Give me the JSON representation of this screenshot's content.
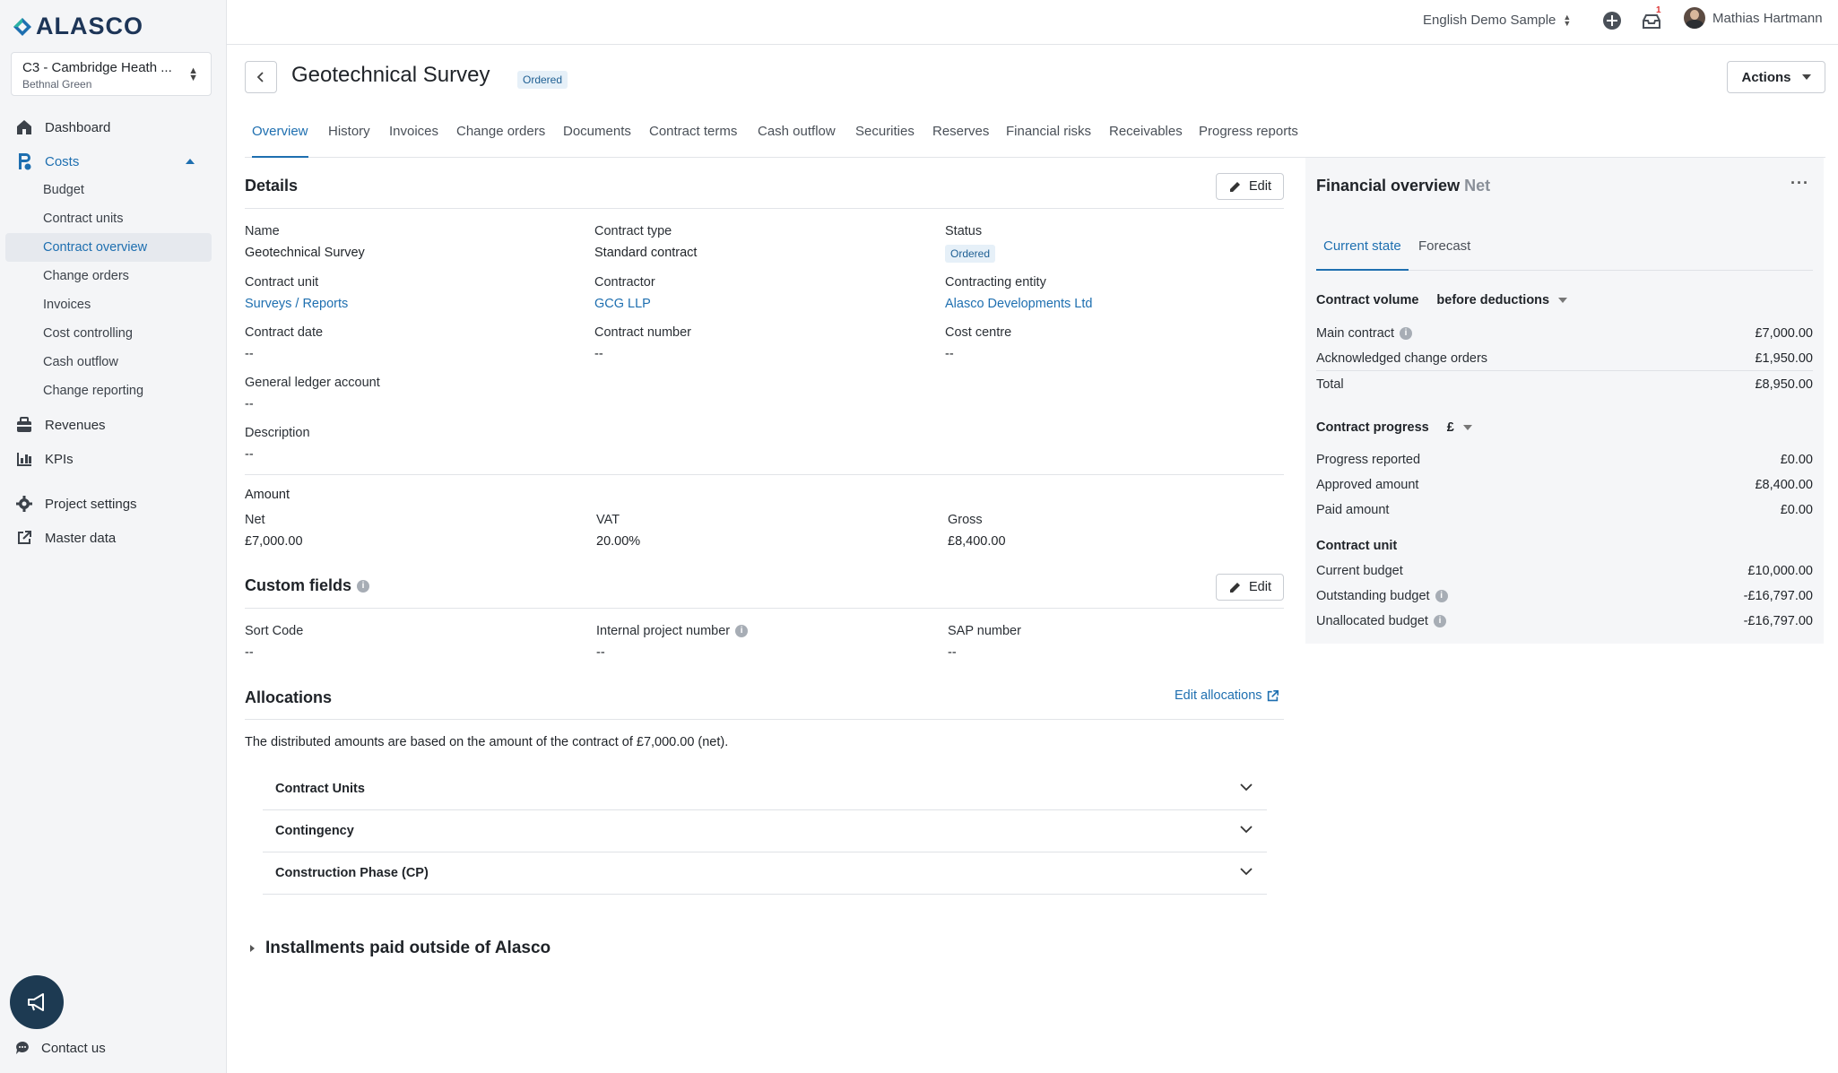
{
  "app": {
    "logo_text": "ALASCO",
    "project_name": "C3 - Cambridge Heath ...",
    "project_location": "Bethnal Green"
  },
  "nav": {
    "dashboard": "Dashboard",
    "costs": "Costs",
    "costs_children": [
      "Budget",
      "Contract units",
      "Contract overview",
      "Change orders",
      "Invoices",
      "Cost controlling",
      "Cash outflow",
      "Change reporting"
    ],
    "revenues": "Revenues",
    "kpis": "KPIs",
    "project_settings": "Project settings",
    "master_data": "Master data",
    "contact": "Contact us"
  },
  "topbar": {
    "language": "English Demo Sample",
    "notification_count": "1",
    "user_name": "Mathias Hartmann"
  },
  "header": {
    "title": "Geotechnical Survey",
    "status_badge": "Ordered",
    "actions_label": "Actions"
  },
  "tabs": [
    "Overview",
    "History",
    "Invoices",
    "Change orders",
    "Documents",
    "Contract terms",
    "Cash outflow",
    "Securities",
    "Reserves",
    "Financial risks",
    "Receivables",
    "Progress reports"
  ],
  "details": {
    "title": "Details",
    "edit_label": "Edit",
    "name_label": "Name",
    "name_value": "Geotechnical Survey",
    "contract_type_label": "Contract type",
    "contract_type_value": "Standard contract",
    "status_label": "Status",
    "status_value": "Ordered",
    "contract_unit_label": "Contract unit",
    "contract_unit_value": "Surveys / Reports",
    "contractor_label": "Contractor",
    "contractor_value": "GCG LLP",
    "contracting_entity_label": "Contracting entity",
    "contracting_entity_value": "Alasco Developments Ltd",
    "contract_date_label": "Contract date",
    "contract_date_value": "--",
    "contract_number_label": "Contract number",
    "contract_number_value": "--",
    "cost_centre_label": "Cost centre",
    "cost_centre_value": "--",
    "gl_account_label": "General ledger account",
    "gl_account_value": "--",
    "description_label": "Description",
    "description_value": "--",
    "amount_label": "Amount",
    "net_label": "Net",
    "net_value": "£7,000.00",
    "vat_label": "VAT",
    "vat_value": "20.00%",
    "gross_label": "Gross",
    "gross_value": "£8,400.00"
  },
  "custom_fields": {
    "title": "Custom fields",
    "edit_label": "Edit",
    "sort_code_label": "Sort Code",
    "sort_code_value": "--",
    "internal_project_label": "Internal project number",
    "internal_project_value": "--",
    "sap_label": "SAP number",
    "sap_value": "--"
  },
  "allocations": {
    "title": "Allocations",
    "edit_link": "Edit allocations",
    "note": "The distributed amounts are based on the amount of the contract of £7,000.00 (net).",
    "rows": [
      "Contract Units",
      "Contingency",
      "Construction Phase (CP)"
    ]
  },
  "installments": {
    "title": "Installments paid outside of Alasco"
  },
  "financial_overview": {
    "title": "Financial overview",
    "title_suffix": "Net",
    "tabs": [
      "Current state",
      "Forecast"
    ],
    "contract_volume_label": "Contract volume",
    "contract_volume_select": "before deductions",
    "main_contract_label": "Main contract",
    "main_contract_value": "£7,000.00",
    "ack_change_orders_label": "Acknowledged change orders",
    "ack_change_orders_value": "£1,950.00",
    "total_label": "Total",
    "total_value": "£8,950.00",
    "contract_progress_label": "Contract progress",
    "contract_progress_select": "£",
    "progress_reported_label": "Progress reported",
    "progress_reported_value": "£0.00",
    "approved_amount_label": "Approved amount",
    "approved_amount_value": "£8,400.00",
    "paid_amount_label": "Paid amount",
    "paid_amount_value": "£0.00",
    "contract_unit_label": "Contract unit",
    "current_budget_label": "Current budget",
    "current_budget_value": "£10,000.00",
    "outstanding_budget_label": "Outstanding budget",
    "outstanding_budget_value": "-£16,797.00",
    "unallocated_budget_label": "Unallocated budget",
    "unallocated_budget_value": "-£16,797.00"
  },
  "colors": {
    "accent": "#1e6fb0",
    "sidebar_bg": "#f4f5f7",
    "fab_bg": "#1d3a52"
  }
}
